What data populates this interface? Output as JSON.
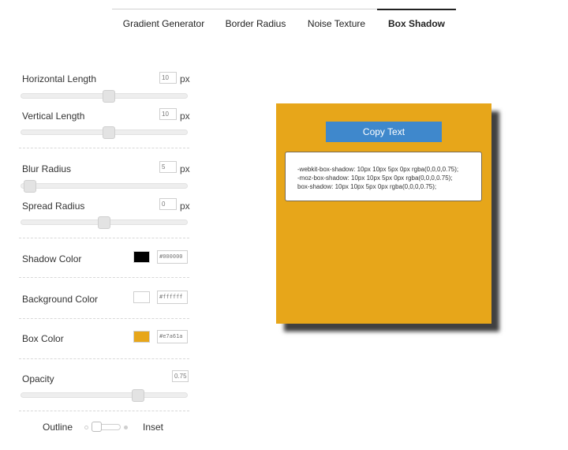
{
  "tabs": [
    {
      "label": "Gradient Generator"
    },
    {
      "label": "Border Radius"
    },
    {
      "label": "Noise Texture"
    },
    {
      "label": "Box Shadow",
      "active": true
    }
  ],
  "controls": {
    "horizontal": {
      "label": "Horizontal Length",
      "value": "10",
      "unit": "px",
      "slider_fraction": 0.53
    },
    "vertical": {
      "label": "Vertical Length",
      "value": "10",
      "unit": "px",
      "slider_fraction": 0.53
    },
    "blur": {
      "label": "Blur Radius",
      "value": "5",
      "unit": "px",
      "slider_fraction": 0.02
    },
    "spread": {
      "label": "Spread Radius",
      "value": "0",
      "unit": "px",
      "slider_fraction": 0.5
    },
    "shadow_color": {
      "label": "Shadow Color",
      "value": "#000000",
      "color": "#000000"
    },
    "background_color": {
      "label": "Background Color",
      "value": "#ffffff",
      "color": "#ffffff"
    },
    "box_color": {
      "label": "Box Color",
      "value": "#e7a61a",
      "color": "#e7a61a"
    },
    "opacity": {
      "label": "Opacity",
      "value": "0.75",
      "slider_fraction": 0.72
    },
    "toggle": {
      "left_label": "Outline",
      "right_label": "Inset",
      "inset": false
    }
  },
  "preview": {
    "copy_label": "Copy Text",
    "code_lines": [
      "-webkit-box-shadow: 10px 10px 5px 0px rgba(0,0,0,0.75);",
      "-moz-box-shadow: 10px 10px 5px 0px rgba(0,0,0,0.75);",
      "box-shadow: 10px 10px 5px 0px rgba(0,0,0,0.75);"
    ]
  }
}
